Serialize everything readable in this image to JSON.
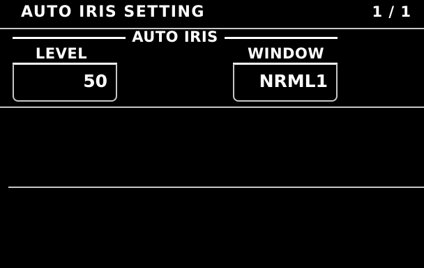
{
  "header": {
    "title": "AUTO IRIS SETTING",
    "page_indicator": "1 / 1"
  },
  "group": {
    "label": "AUTO IRIS"
  },
  "params": [
    {
      "label": "LEVEL",
      "value": "50"
    },
    {
      "label": "WINDOW",
      "value": "NRML1"
    }
  ]
}
